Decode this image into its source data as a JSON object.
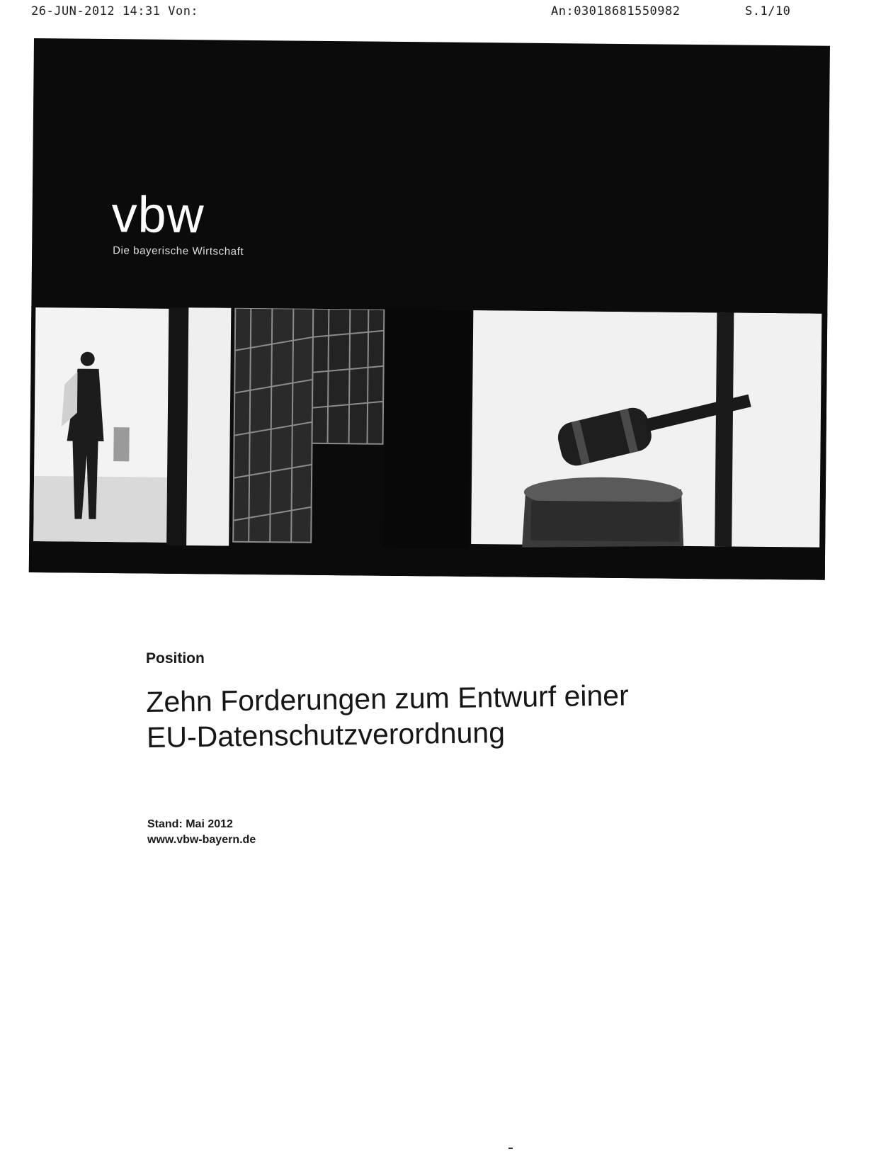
{
  "fax_header": {
    "datetime_from": "26-JUN-2012 14:31 Von:",
    "to": "An:03018681550982",
    "page": "S.1/10"
  },
  "cover": {
    "logo_text": "vbw",
    "tagline": "Die bayerische Wirtschaft"
  },
  "document": {
    "kicker": "Position",
    "title_lines": [
      "Zehn Forderungen zum Entwurf einer",
      "EU-Datenschutzverordnung"
    ],
    "stand": "Stand: Mai 2012",
    "website": "www.vbw-bayern.de"
  }
}
